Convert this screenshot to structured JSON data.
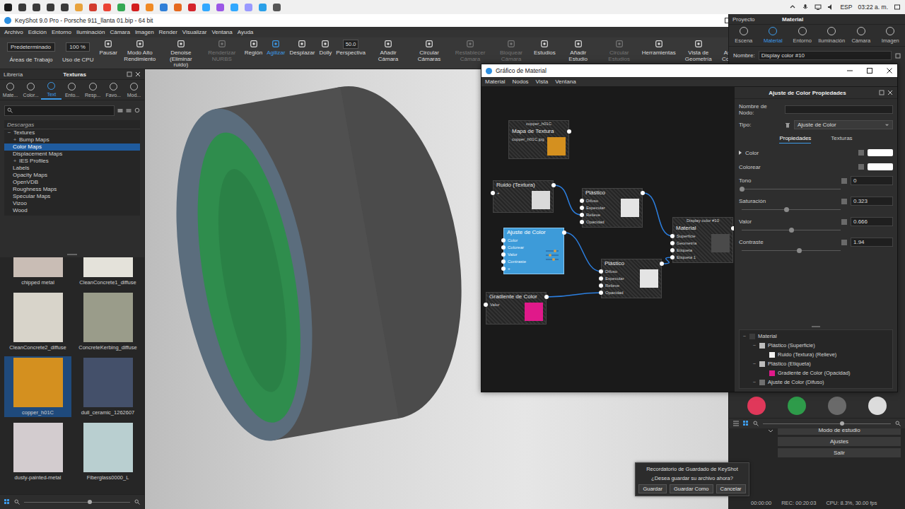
{
  "taskbar": {
    "apps": [
      {
        "color": "#1b1b1b"
      },
      {
        "color": "#3a3a3a"
      },
      {
        "color": "#3a3a3a"
      },
      {
        "color": "#3a3a3a"
      },
      {
        "color": "#3a3a3a"
      },
      {
        "color": "#e8a33d"
      },
      {
        "color": "#d23b2e"
      },
      {
        "color": "#ea4335"
      },
      {
        "color": "#34a853"
      },
      {
        "color": "#d31e1e"
      },
      {
        "color": "#f08a24"
      },
      {
        "color": "#2f7fd8"
      },
      {
        "color": "#e5691f"
      },
      {
        "color": "#d4242b"
      },
      {
        "color": "#31a8ff"
      },
      {
        "color": "#9b57e6"
      },
      {
        "color": "#31a8ff"
      },
      {
        "color": "#9999ff"
      },
      {
        "color": "#2aa0e8"
      },
      {
        "color": "#555555"
      }
    ],
    "language": "ESP",
    "clock": "03:22 a. m."
  },
  "window": {
    "title": "KeyShot 9.0 Pro - Porsche 911_llanta 01.bip - 64 bit"
  },
  "menu": [
    "Archivo",
    "Edición",
    "Entorno",
    "Iluminación",
    "Cámara",
    "Imagen",
    "Render",
    "Visualizar",
    "Ventana",
    "Ayuda"
  ],
  "toolbar": {
    "workspace": "Predeterminado",
    "workspace_label": "Áreas de Trabajo",
    "cpu": "100 %",
    "cpu_label": "Uso de CPU",
    "tools": [
      {
        "label": "Pausar",
        "disabled": false,
        "selected": false,
        "field": ""
      },
      {
        "label": "Modo Alto Rendimiento",
        "disabled": false,
        "selected": false,
        "field": ""
      },
      {
        "label": "Denoise (Eliminar ruido)",
        "disabled": false,
        "selected": false,
        "field": ""
      },
      {
        "label": "Renderizar NURBS",
        "disabled": true,
        "selected": false,
        "field": ""
      },
      {
        "label": "Región",
        "disabled": false,
        "selected": false,
        "field": ""
      },
      {
        "label": "Agilizar",
        "disabled": false,
        "selected": true,
        "field": ""
      },
      {
        "label": "Desplazar",
        "disabled": false,
        "selected": false,
        "field": ""
      },
      {
        "label": "Dolly",
        "disabled": false,
        "selected": false,
        "field": ""
      },
      {
        "label": "Perspectiva",
        "disabled": false,
        "selected": false,
        "field": "50.0"
      },
      {
        "label": "Añadir Cámara",
        "disabled": false,
        "selected": false,
        "field": ""
      },
      {
        "label": "Circular Cámaras",
        "disabled": false,
        "selected": false,
        "field": ""
      },
      {
        "label": "Restablecer Cámara",
        "disabled": true,
        "selected": false,
        "field": ""
      },
      {
        "label": "Bloquear Cámara",
        "disabled": true,
        "selected": false,
        "field": ""
      },
      {
        "label": "Estudios",
        "disabled": false,
        "selected": false,
        "field": ""
      },
      {
        "label": "Añadir Estudio",
        "disabled": false,
        "selected": false,
        "field": ""
      },
      {
        "label": "Circular Estudios",
        "disabled": true,
        "selected": false,
        "field": ""
      },
      {
        "label": "Herramientas",
        "disabled": false,
        "selected": false,
        "field": ""
      },
      {
        "label": "Vista de Geometría",
        "disabled": false,
        "selected": false,
        "field": ""
      },
      {
        "label": "Asistente de Configuración",
        "disabled": false,
        "selected": false,
        "field": ""
      }
    ]
  },
  "library": {
    "title": "Librería",
    "tab": "Texturas",
    "categories": [
      {
        "label": "Mate...",
        "selected": false
      },
      {
        "label": "Color...",
        "selected": false
      },
      {
        "label": "Text",
        "selected": true
      },
      {
        "label": "Ento...",
        "selected": false
      },
      {
        "label": "Resp...",
        "selected": false
      },
      {
        "label": "Favo...",
        "selected": false
      },
      {
        "label": "Mod...",
        "selected": false
      }
    ],
    "tree": [
      {
        "label": "Descargas",
        "kind": "header",
        "toggle": "",
        "selected": false,
        "depth": 0
      },
      {
        "label": "Textures",
        "kind": "item",
        "toggle": "−",
        "selected": false,
        "depth": 0
      },
      {
        "label": "Bump Maps",
        "kind": "item",
        "toggle": "+",
        "selected": false,
        "depth": 1
      },
      {
        "label": "Color Maps",
        "kind": "item",
        "toggle": "",
        "selected": true,
        "depth": 1
      },
      {
        "label": "Displacement Maps",
        "kind": "item",
        "toggle": "",
        "selected": false,
        "depth": 1
      },
      {
        "label": "IES Profiles",
        "kind": "item",
        "toggle": "+",
        "selected": false,
        "depth": 1
      },
      {
        "label": "Labels",
        "kind": "item",
        "toggle": "",
        "selected": false,
        "depth": 1
      },
      {
        "label": "Opacity Maps",
        "kind": "item",
        "toggle": "",
        "selected": false,
        "depth": 1
      },
      {
        "label": "OpenVDB",
        "kind": "item",
        "toggle": "",
        "selected": false,
        "depth": 1
      },
      {
        "label": "Roughness Maps",
        "kind": "item",
        "toggle": "",
        "selected": false,
        "depth": 1
      },
      {
        "label": "Specular Maps",
        "kind": "item",
        "toggle": "",
        "selected": false,
        "depth": 1
      },
      {
        "label": "Vizoo",
        "kind": "item",
        "toggle": "",
        "selected": false,
        "depth": 1
      },
      {
        "label": "Wood",
        "kind": "item",
        "toggle": "",
        "selected": false,
        "depth": 1
      }
    ],
    "thumbnails": [
      {
        "label": "chipped metal",
        "color": "#c9bdb5",
        "selected": false
      },
      {
        "label": "CleanConcrete1_diffuse",
        "color": "#e4e2da",
        "selected": false
      },
      {
        "label": "CleanConcrete2_diffuse",
        "color": "#d8d4ca",
        "selected": false
      },
      {
        "label": "ConcreteKerbing_diffuse",
        "color": "#9a9c8a",
        "selected": false
      },
      {
        "label": "copper_h01C",
        "color": "#d4901f",
        "selected": true
      },
      {
        "label": "dull_ceramic_1262607",
        "color": "#44506a",
        "selected": false
      },
      {
        "label": "dusty-painted-metal",
        "color": "#d3cccf",
        "selected": false
      },
      {
        "label": "Fiberglass0000_L",
        "color": "#b9cfd0",
        "selected": false
      }
    ]
  },
  "project": {
    "header": "Proyecto",
    "title": "Material",
    "tabs": [
      {
        "label": "Escena",
        "selected": false
      },
      {
        "label": "Material",
        "selected": true
      },
      {
        "label": "Entorno",
        "selected": false
      },
      {
        "label": "Iluminación",
        "selected": false
      },
      {
        "label": "Cámara",
        "selected": false
      },
      {
        "label": "Imagen",
        "selected": false
      }
    ],
    "name_label": "Nombre:",
    "name": "Display color #10",
    "materials": [
      {
        "color": "#e0385a"
      },
      {
        "color": "#2e9b4a"
      },
      {
        "color": "#6a6a6a"
      },
      {
        "color": "#dcdcdc"
      }
    ]
  },
  "graph": {
    "title": "Gráfico de Material",
    "menu": [
      "Material",
      "Nodos",
      "Vista",
      "Ventana"
    ],
    "nodes": [
      {
        "title": "Mapa de Textura",
        "caption": "copper_h01C",
        "subtitle": "copper_h01C.jpg",
        "ports": [],
        "thumb": "#d4901f",
        "selected": false
      },
      {
        "title": "Ruido (Textura)",
        "caption": "",
        "subtitle": "",
        "ports": [
          "+"
        ],
        "thumb": "#dadada",
        "selected": false
      },
      {
        "title": "Plástico",
        "caption": "",
        "subtitle": "",
        "ports": [
          "Difuso",
          "Especular",
          "Relieve",
          "Opacidad"
        ],
        "thumb": "#e4e4e4",
        "selected": false
      },
      {
        "title": "Ajuste de Color",
        "caption": "",
        "subtitle": "",
        "ports": [
          "Color",
          "Colorear",
          "Valor",
          "Contraste",
          "+"
        ],
        "thumb": "",
        "selected": true
      },
      {
        "title": "Plástico",
        "caption": "",
        "subtitle": "",
        "ports": [
          "Difuso",
          "Especular",
          "Relieve",
          "Opacidad"
        ],
        "thumb": "#e4e4e4",
        "selected": false
      },
      {
        "title": "Gradiente de Color",
        "caption": "",
        "subtitle": "",
        "ports": [
          "Valor"
        ],
        "thumb": "#e0198a",
        "selected": false
      },
      {
        "title": "Material",
        "caption": "Display color #10",
        "subtitle": "",
        "ports": [
          "Superficie",
          "Geometría",
          "Etiqueta",
          "Etiqueta 1"
        ],
        "thumb": "#4a4a4a",
        "selected": false
      }
    ],
    "edges": [
      {
        "from": 1,
        "to": 2,
        "port": 2
      },
      {
        "from": 2,
        "to": 6,
        "port": 0
      },
      {
        "from": 3,
        "to": 4,
        "port": 0
      },
      {
        "from": 5,
        "to": 4,
        "port": 3
      },
      {
        "from": 4,
        "to": 6,
        "port": 3
      }
    ]
  },
  "properties": {
    "title": "Ajuste de Color Propiedades",
    "name_label": "Nombre de Nodo:",
    "name_value": "",
    "type_label": "Tipo:",
    "type_value": "Ajuste de Color",
    "tabs": [
      {
        "label": "Propiedades",
        "selected": true
      },
      {
        "label": "Texturas",
        "selected": false
      }
    ],
    "params": [
      {
        "kind": "color",
        "label": "Color",
        "expandable": true,
        "color": "#ffffff",
        "value": "",
        "level": 0
      },
      {
        "kind": "color",
        "label": "Colorear",
        "expandable": false,
        "color": "#ffffff",
        "value": "",
        "level": 0
      },
      {
        "kind": "slider",
        "label": "Tono",
        "expandable": false,
        "color": "",
        "value": "0",
        "level": 0
      },
      {
        "kind": "slider",
        "label": "Saturación",
        "expandable": false,
        "color": "",
        "value": "0.323",
        "level": 0.45
      },
      {
        "kind": "slider",
        "label": "Valor",
        "expandable": false,
        "color": "",
        "value": "0.666",
        "level": 0.5
      },
      {
        "kind": "slider",
        "label": "Contraste",
        "expandable": false,
        "color": "",
        "value": "1.94",
        "level": 0.58
      }
    ],
    "tree": [
      {
        "label": "Material",
        "depth": 0,
        "toggle": "−",
        "color": "#3c3c3c"
      },
      {
        "label": "Plástico (Superficie)",
        "depth": 1,
        "toggle": "−",
        "color": "#bdbdbd"
      },
      {
        "label": "Ruido (Textura) (Relieve)",
        "depth": 2,
        "toggle": "",
        "color": "#f2f2f2"
      },
      {
        "label": "Plástico (Etiqueta)",
        "depth": 1,
        "toggle": "−",
        "color": "#bdbdbd"
      },
      {
        "label": "Gradiente de Color (Opacidad)",
        "depth": 2,
        "toggle": "",
        "color": "#e0198a"
      },
      {
        "label": "Ajuste de Color (Difuso)",
        "depth": 1,
        "toggle": "−",
        "color": "#707070"
      }
    ]
  },
  "side_buttons": [
    "Modo de estudio",
    "Ajustes",
    "Salir"
  ],
  "save_dialog": {
    "title": "Recordatorio de Guardado de KeyShot",
    "message": "¿Desea guardar su archivo ahora?",
    "buttons": [
      "Guardar",
      "Guardar Como",
      "Cancelar"
    ]
  },
  "status": {
    "time": "00:00:00",
    "rec": "REC: 00:20:03",
    "cpu": "CPU: 8.3%, 30.00 fps"
  }
}
